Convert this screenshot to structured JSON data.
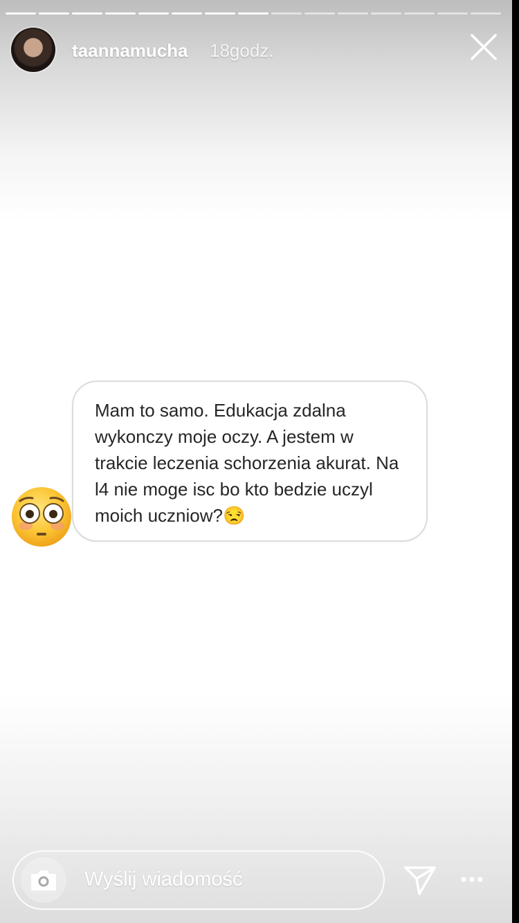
{
  "header": {
    "username": "taannamucha",
    "time": "18godz.",
    "progress": {
      "segments": 15,
      "current": 8
    }
  },
  "question": {
    "text": "Mam to samo. Edukacja zdalna wykonczy moje oczy. A jestem w trakcie leczenia schorzenia akurat. Na l4 nie moge isc bo kto bedzie uczyl moich uczniow?😒"
  },
  "sticker": {
    "icon": "flushed-face-icon"
  },
  "reply_bar": {
    "placeholder": "Wyślij wiadomość",
    "camera_icon": "camera-icon",
    "send_icon": "paper-plane-icon",
    "more_icon": "more-dots-icon"
  },
  "colors": {
    "text": "#262626",
    "bubble_border": "#dcdcdc",
    "overlay_text": "#ffffff"
  }
}
